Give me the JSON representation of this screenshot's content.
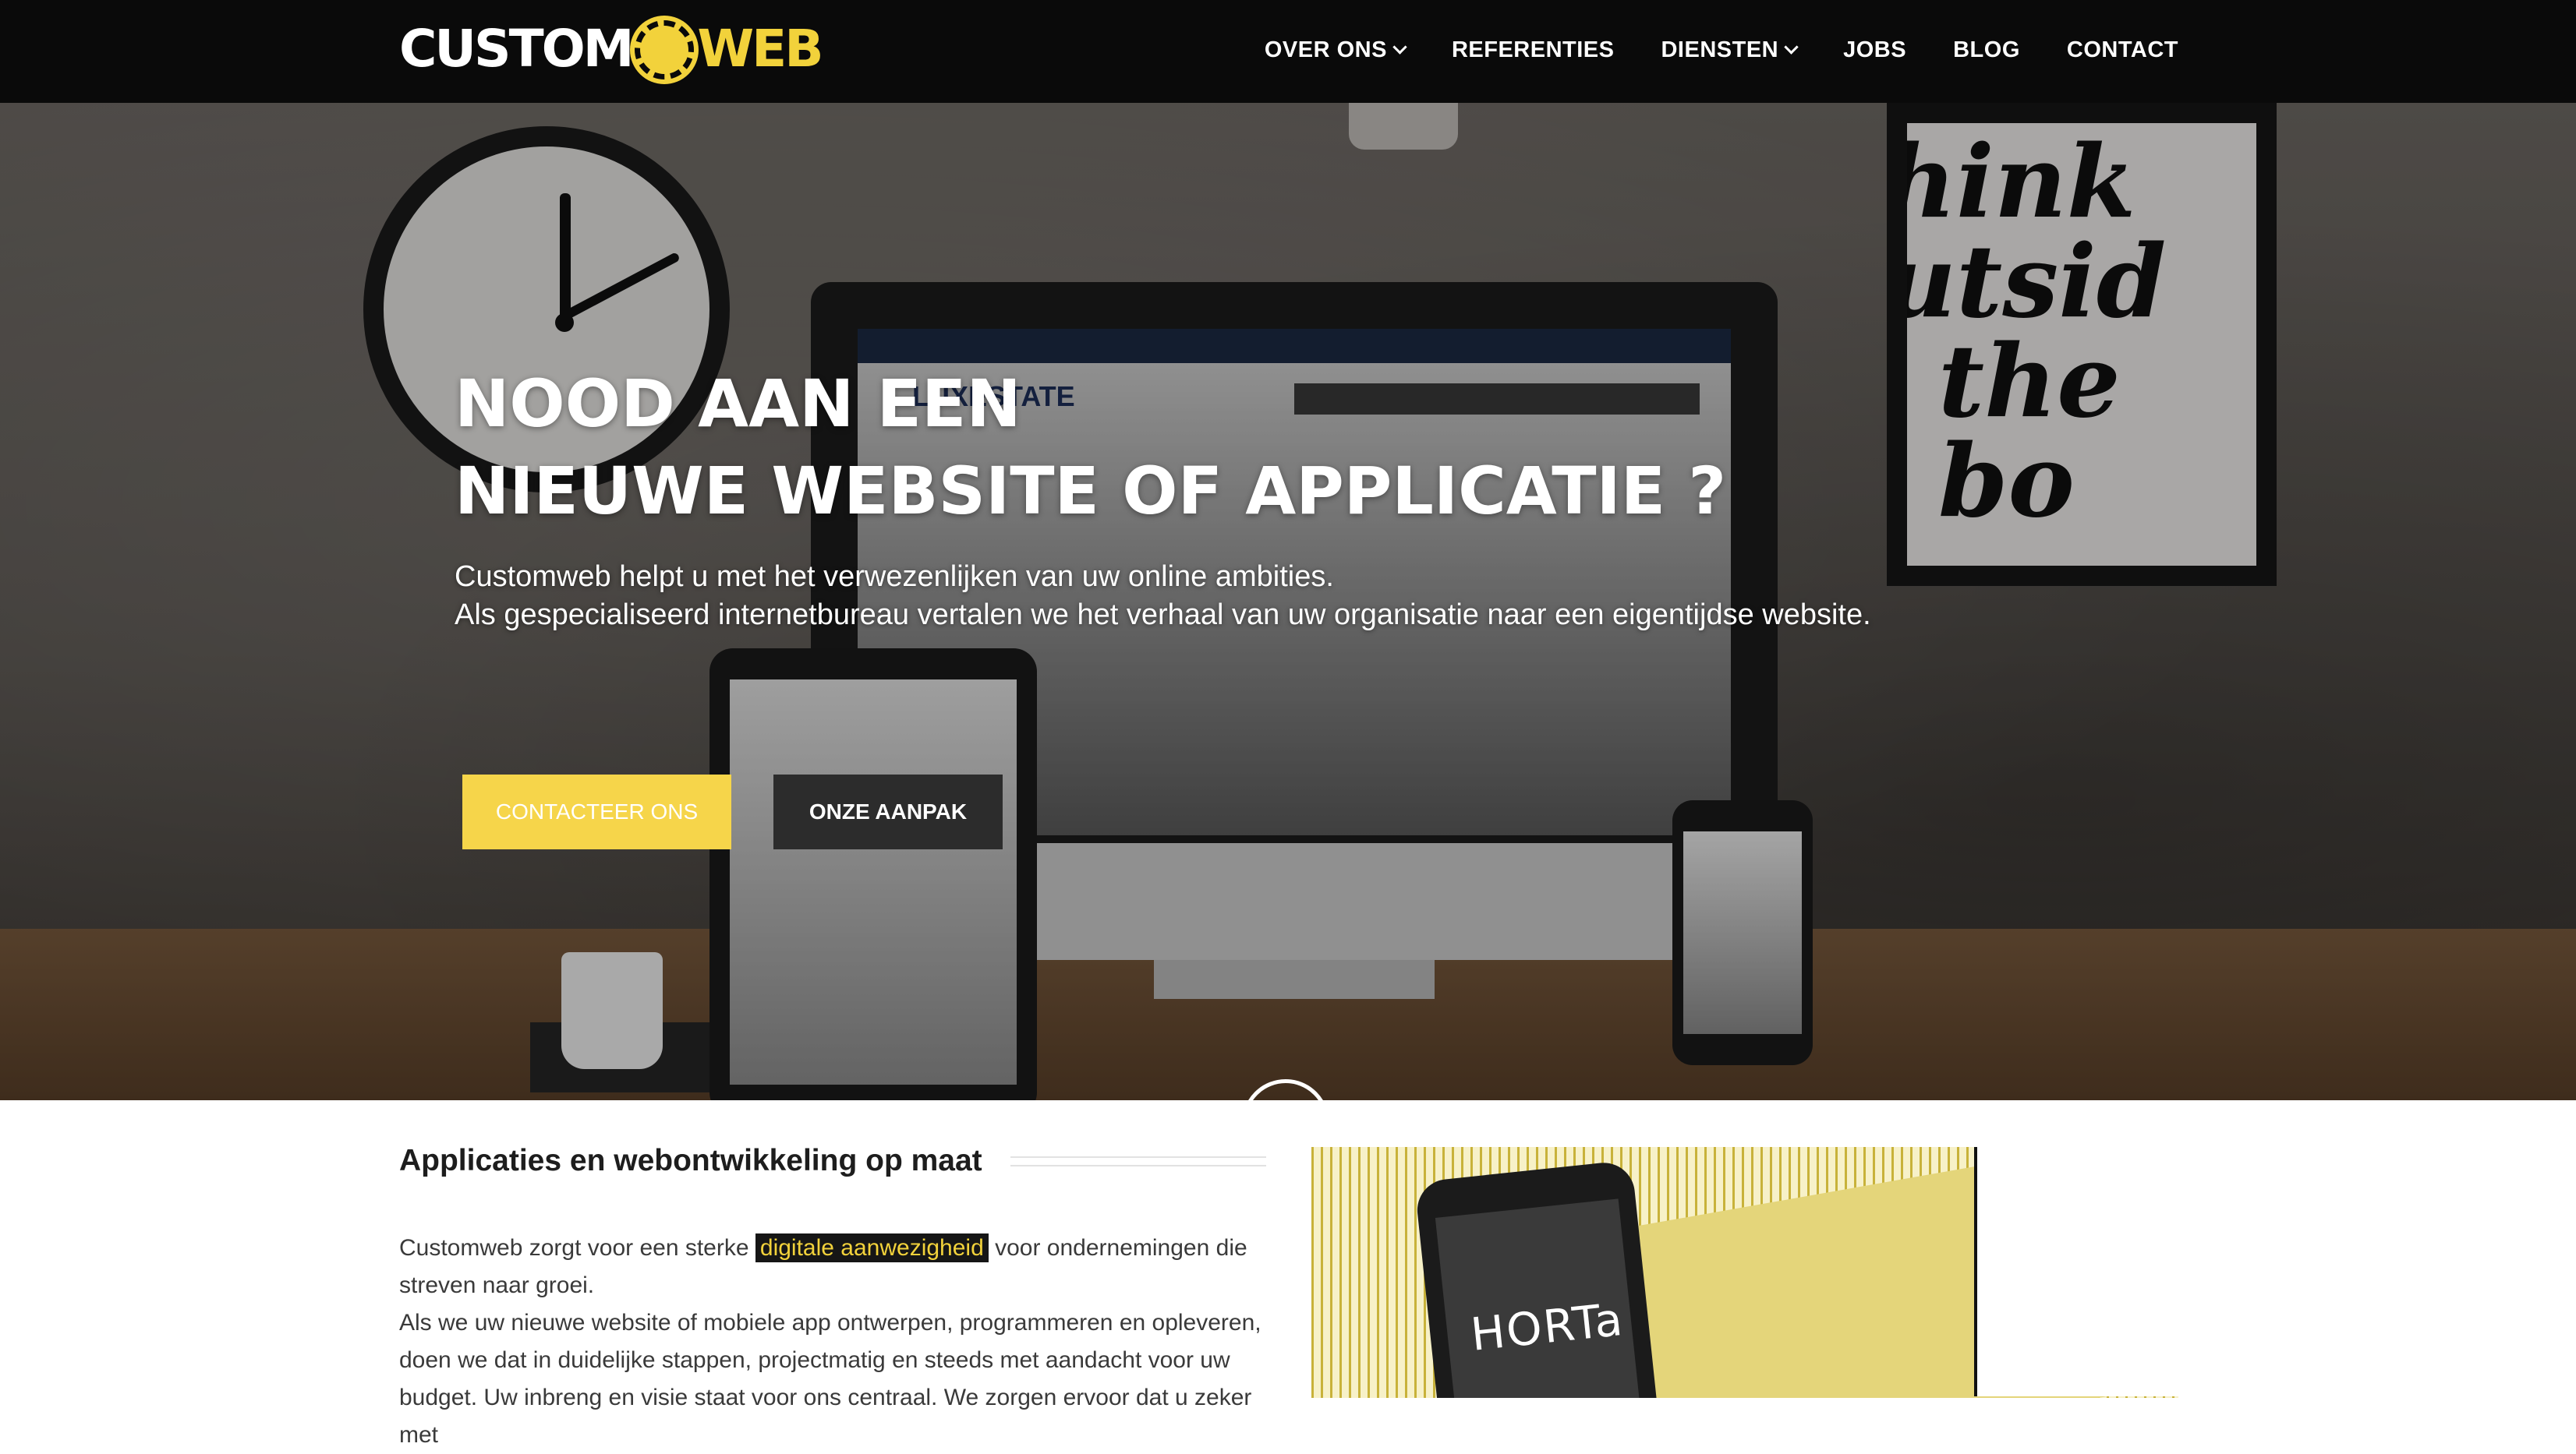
{
  "logo": {
    "part1": "CUSTOM",
    "part2": "WEB"
  },
  "nav": {
    "items": [
      {
        "label": "OVER ONS",
        "has_dropdown": true
      },
      {
        "label": "REFERENTIES",
        "has_dropdown": false
      },
      {
        "label": "DIENSTEN",
        "has_dropdown": true
      },
      {
        "label": "JOBS",
        "has_dropdown": false
      },
      {
        "label": "BLOG",
        "has_dropdown": false
      },
      {
        "label": "CONTACT",
        "has_dropdown": false
      }
    ]
  },
  "hero": {
    "title_line1": "NOOD AAN EEN",
    "title_line2": "NIEUWE WEBSITE OF APPLICATIE ?",
    "subtitle_line1": "Customweb helpt u met het verwezenlijken van uw online ambities.",
    "subtitle_line2": "Als gespecialiseerd internetbureau vertalen we het verhaal van uw organisatie naar een eigentijdse website.",
    "primary_button": "CONTACTEER ONS",
    "secondary_button": "ONZE AANPAK",
    "poster_lines": [
      "hink",
      "utsid",
      "the",
      "bo"
    ],
    "screen_brand": "LUXESTATE"
  },
  "intro": {
    "heading": "Applicaties en webontwikkeling op maat",
    "para1_before": "Customweb zorgt voor een sterke",
    "para1_highlight": "digitale aanwezigheid",
    "para1_after": "voor ondernemingen die streven naar groei.",
    "para2": "Als we uw nieuwe website of mobiele app ontwerpen, programmeren en opleveren, doen we dat in duidelijke stappen, projectmatig en steeds met aandacht voor uw",
    "para3": "budget. Uw inbreng en visie staat voor ons centraal. We zorgen ervoor dat u zeker met",
    "image_text": "HORTa"
  },
  "colors": {
    "accent": "#f6d54a",
    "nav_bg": "#0a0a0a",
    "dark_button": "#2c2c2c"
  },
  "icons": {
    "dropdown": "chevron-down-icon",
    "scroll": "arrow-down-circle-icon"
  }
}
